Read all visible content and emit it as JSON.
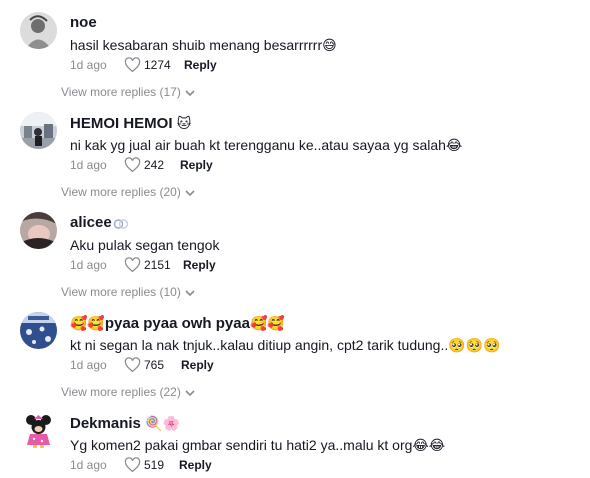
{
  "comments": [
    {
      "username": "noe",
      "text": "hasil kesabaran shuib menang besarrrrrr",
      "text_emoji": "😅",
      "time": "1d ago",
      "likes": "1274",
      "reply_label": "Reply",
      "more_replies": "View more replies (17)"
    },
    {
      "username": "HEMOI HEMOI",
      "username_emoji": "🐱",
      "text": "ni kak yg jual air buah kt terengganu ke..atau sayaa yg salah",
      "text_emoji": "😂",
      "time": "1d ago",
      "likes": "242",
      "reply_label": "Reply",
      "more_replies": "View more replies (20)"
    },
    {
      "username": "alicee",
      "text": "Aku pulak segan tengok",
      "time": "1d ago",
      "likes": "2151",
      "reply_label": "Reply",
      "more_replies": "View more replies (10)"
    },
    {
      "username_prefix": "🥰🥰",
      "username": "pyaa pyaa owh pyaa",
      "username_emoji": "🥰🥰",
      "text": "kt ni segan la nak tnjuk..kalau ditiup angin, cpt2 tarik tudung..",
      "text_emoji": "🥺🥺🥺",
      "time": "1d ago",
      "likes": "765",
      "reply_label": "Reply",
      "more_replies": "View more replies (22)"
    },
    {
      "username": "Dekmanis",
      "username_emoji": "🍭🌸",
      "text": "Yg komen2 pakai gmbar sendiri tu hati2 ya..malu kt org",
      "text_emoji": "😂😂",
      "time": "1d ago",
      "likes": "519",
      "reply_label": "Reply"
    }
  ],
  "icons": {
    "like": "heart-outline-icon",
    "expand": "chevron-down-icon",
    "username_badge_alicee": "rings-icon"
  },
  "colors": {
    "text": "#161823",
    "secondary": "#8a8b91"
  }
}
